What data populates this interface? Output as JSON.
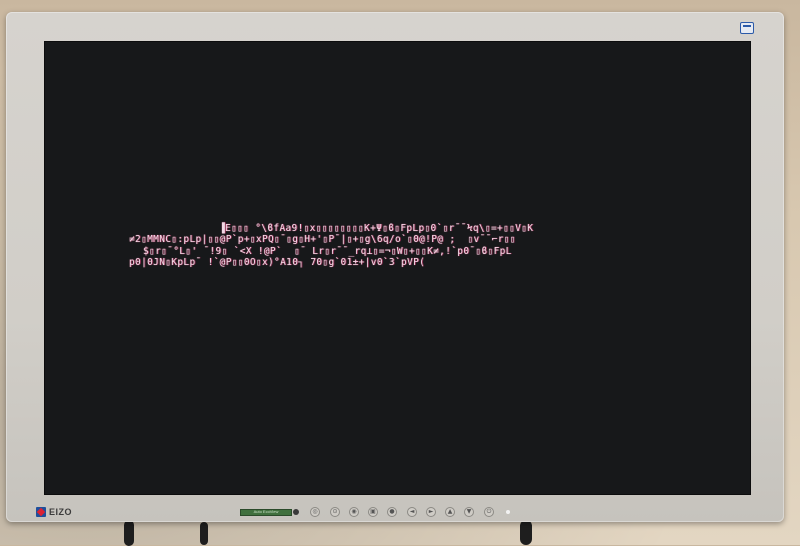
{
  "monitor": {
    "brand": "EIZO",
    "sensor_label": "Auto EcoView",
    "accent_colors": {
      "bezel": "#d3d0ca",
      "screen": "#17181a",
      "glyph": "#f2d9e6",
      "glyph_glow": "#ff4f8f",
      "logo_blue": "#1f4f9c"
    },
    "front_buttons": [
      {
        "icon": "circle-slash-icon",
        "glyph": "◎"
      },
      {
        "icon": "input-icon",
        "glyph": "⊙"
      },
      {
        "icon": "mode-icon",
        "glyph": "◉"
      },
      {
        "icon": "menu-icon",
        "glyph": "▣"
      },
      {
        "icon": "enter-icon",
        "glyph": "●"
      },
      {
        "icon": "left-arrow-icon",
        "glyph": "◄"
      },
      {
        "icon": "right-arrow-icon",
        "glyph": "►"
      },
      {
        "icon": "up-arrow-icon",
        "glyph": "▲"
      },
      {
        "icon": "down-arrow-icon",
        "glyph": "▼"
      },
      {
        "icon": "power-icon",
        "glyph": "⏻"
      }
    ]
  },
  "screen": {
    "lines": [
      "▐E▯▯▯ °\\ϐfAa9!▯x▯▯▯▯▯▯▯▯K+Ψ▯ϐ▯FpLp▯0`▯r¯¯Ϟq\\▯=+▯▯V▯K",
      "≠2▯MMNC▯:pLp|▯▯@P`p+▯xPQ▯¯▯g▯H+'▯P¯|▯+▯g\\6q/o`▯0@!P@ ;  ▯v¯¯⌐r▯▯",
      "$▯r▯¯°L▯' ¯!9▯ `<X !@P`  ▯¯ Lr▯r¯¯_rq⊥▯=¬▯W▯+▯▯K≠,!`p0¯▯ϐ▯FpL",
      "p0|0JN▯KpLp¯ !`@P▯▯0O▯x)°A10┐ 70▯g`01±+|v0`3`pVP("
    ]
  }
}
